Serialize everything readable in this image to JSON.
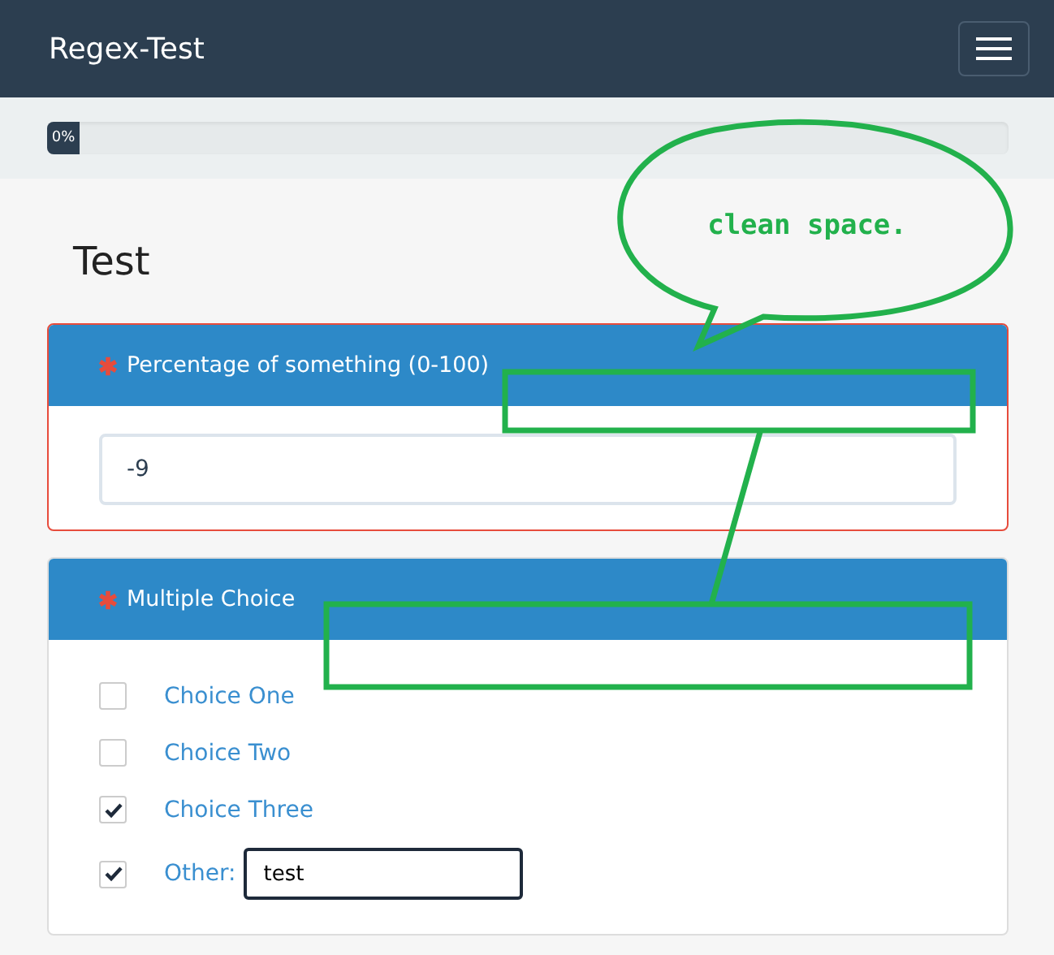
{
  "navbar": {
    "brand": "Regex-Test",
    "menu_expanded": false
  },
  "progress": {
    "label": "0%",
    "level": 0
  },
  "page_title": "Test",
  "questions": [
    {
      "kind": "number",
      "required": true,
      "title": "Percentage of something (0-100)",
      "invalid": true,
      "value": "-9"
    },
    {
      "kind": "checkboxes",
      "required": true,
      "title": "Multiple Choice",
      "invalid": false,
      "options": [
        {
          "label": "Choice One",
          "checked": false
        },
        {
          "label": "Choice Two",
          "checked": false
        },
        {
          "label": "Choice Three",
          "checked": true
        },
        {
          "label": "Other:",
          "checked": true,
          "other_value": "test"
        }
      ]
    }
  ],
  "annotation": {
    "text": "clean space."
  }
}
